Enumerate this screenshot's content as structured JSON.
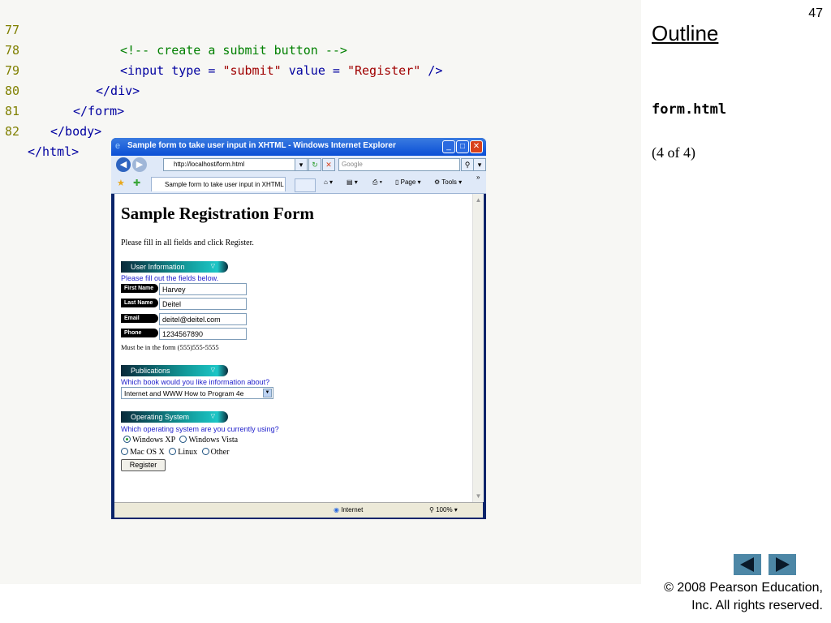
{
  "slide": {
    "page_number": "47",
    "outline_title": "Outline",
    "file_name": "form.html",
    "part_label": "(4 of 4)",
    "copyright_line1": "© 2008 Pearson Education,",
    "copyright_line2": "Inc.  All rights reserved.",
    "nav": {
      "prev_icon": "left-triangle-icon",
      "next_icon": "right-triangle-icon"
    }
  },
  "code": [
    {
      "ln": "77",
      "indent": "            ",
      "comment": "<!-- create a submit button -->"
    },
    {
      "ln": "78",
      "indent": "            ",
      "text": "<input type = ",
      "s1": "\"submit\"",
      "mid": " value = ",
      "s2": "\"Register\"",
      "end": " />"
    },
    {
      "ln": "79",
      "indent": "         ",
      "text": "</div>"
    },
    {
      "ln": "80",
      "indent": "      ",
      "text": "</form>"
    },
    {
      "ln": "81",
      "indent": "   ",
      "text": "</body>"
    },
    {
      "ln": "82",
      "indent": "",
      "text": "</html>"
    }
  ],
  "browser": {
    "title": "Sample form to take user input in XHTML - Windows Internet Explorer",
    "address": "http://localhost/form.html",
    "search_placeholder": "Google",
    "tab_label": "Sample form to take user input in XHTML",
    "cmd_page": "Page",
    "cmd_tools": "Tools",
    "status_zone": "Internet",
    "status_zoom": "100%"
  },
  "form": {
    "heading": "Sample Registration Form",
    "intro": "Please fill in all fields and click Register.",
    "section_user": "User Information",
    "fill_instr": "Please fill out the fields below.",
    "first_name_label": "First Name",
    "first_name": "Harvey",
    "last_name_label": "Last Name",
    "last_name": "Deitel",
    "email_label": "Email",
    "email": "deitel@deitel.com",
    "phone_label": "Phone",
    "phone": "1234567890",
    "phone_note": "Must be in the form (555)555-5555",
    "section_pubs": "Publications",
    "pubs_question": "Which book would you like information about?",
    "book_selected": "Internet and WWW How to Program 4e",
    "section_os": "Operating System",
    "os_question": "Which operating system are you currently using?",
    "os_winxp": "Windows XP",
    "os_vista": "Windows Vista",
    "os_mac": "Mac OS X",
    "os_linux": "Linux",
    "os_other": "Other",
    "selected_os": "Windows XP",
    "submit_label": "Register"
  }
}
